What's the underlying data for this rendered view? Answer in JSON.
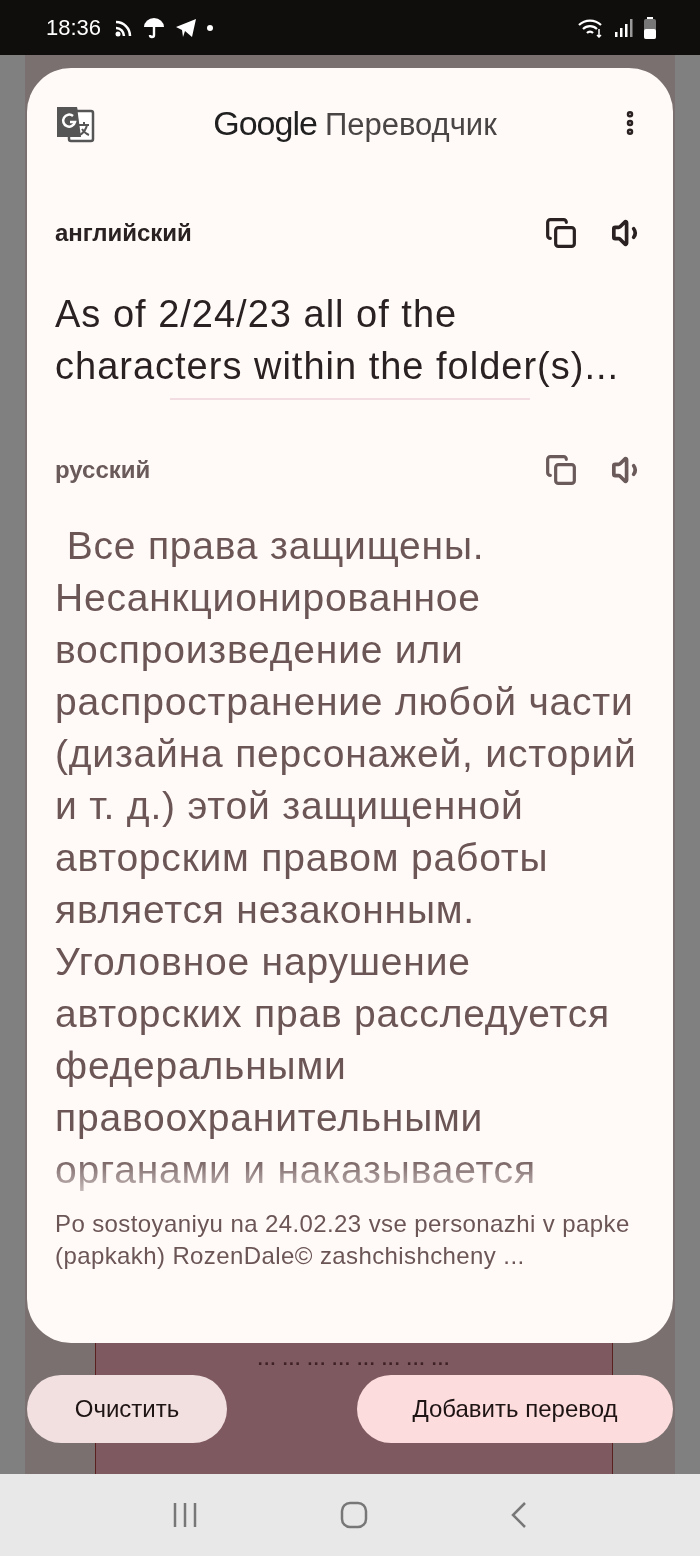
{
  "status_bar": {
    "time": "18:36"
  },
  "header": {
    "brand": "Google",
    "title": "Переводчик"
  },
  "source": {
    "language": "английский",
    "text": "As of 2/24/23 all of the characters within the folder(s)..."
  },
  "target": {
    "language": "русский",
    "text": " Все права защищены. Несанкционированное воспроизведение или распространение любой части (дизайна персонажей, историй и т. д.) этой защищенной авторским правом работы является незаконным.  Уголовное нарушение авторских прав расследуется федеральными правоохранительными органами и наказывается"
  },
  "transliteration": "Po sostoyaniyu na 24.02.23 vse personazhi v papke (papkakh) RozenDale© zashchishcheny ...",
  "background_text": "... ... ... ... ... ... ... ...",
  "buttons": [
    {
      "label": "Очистить",
      "kind": "secondary"
    },
    {
      "label": "Добавить перевод",
      "kind": "primary"
    }
  ]
}
